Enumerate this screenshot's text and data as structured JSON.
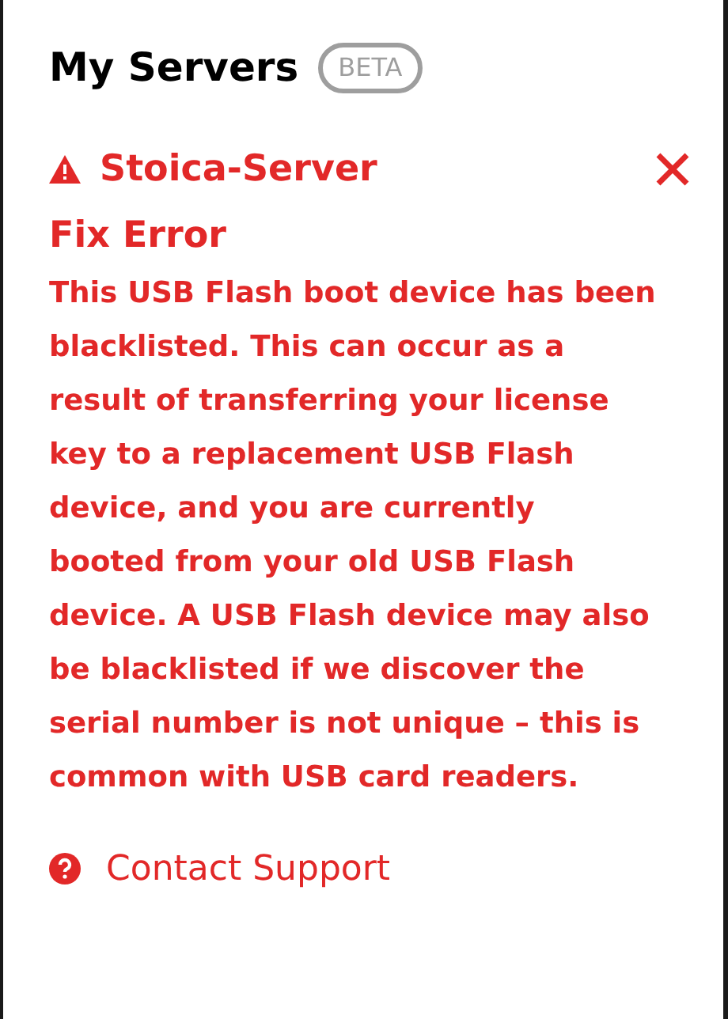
{
  "header": {
    "title": "My Servers",
    "badge": "BETA"
  },
  "server": {
    "name": "Stoica-Server",
    "error": true
  },
  "error": {
    "title": "Fix Error",
    "message": "This USB Flash boot device has been blacklisted. This can occur as a result of transferring your license key to a replacement USB Flash device, and you are currently booted from your old USB Flash device. A USB Flash device may also be blacklisted if we discover the serial number is not unique – this is common with USB card readers."
  },
  "support_link": {
    "label": "Contact Support"
  }
}
